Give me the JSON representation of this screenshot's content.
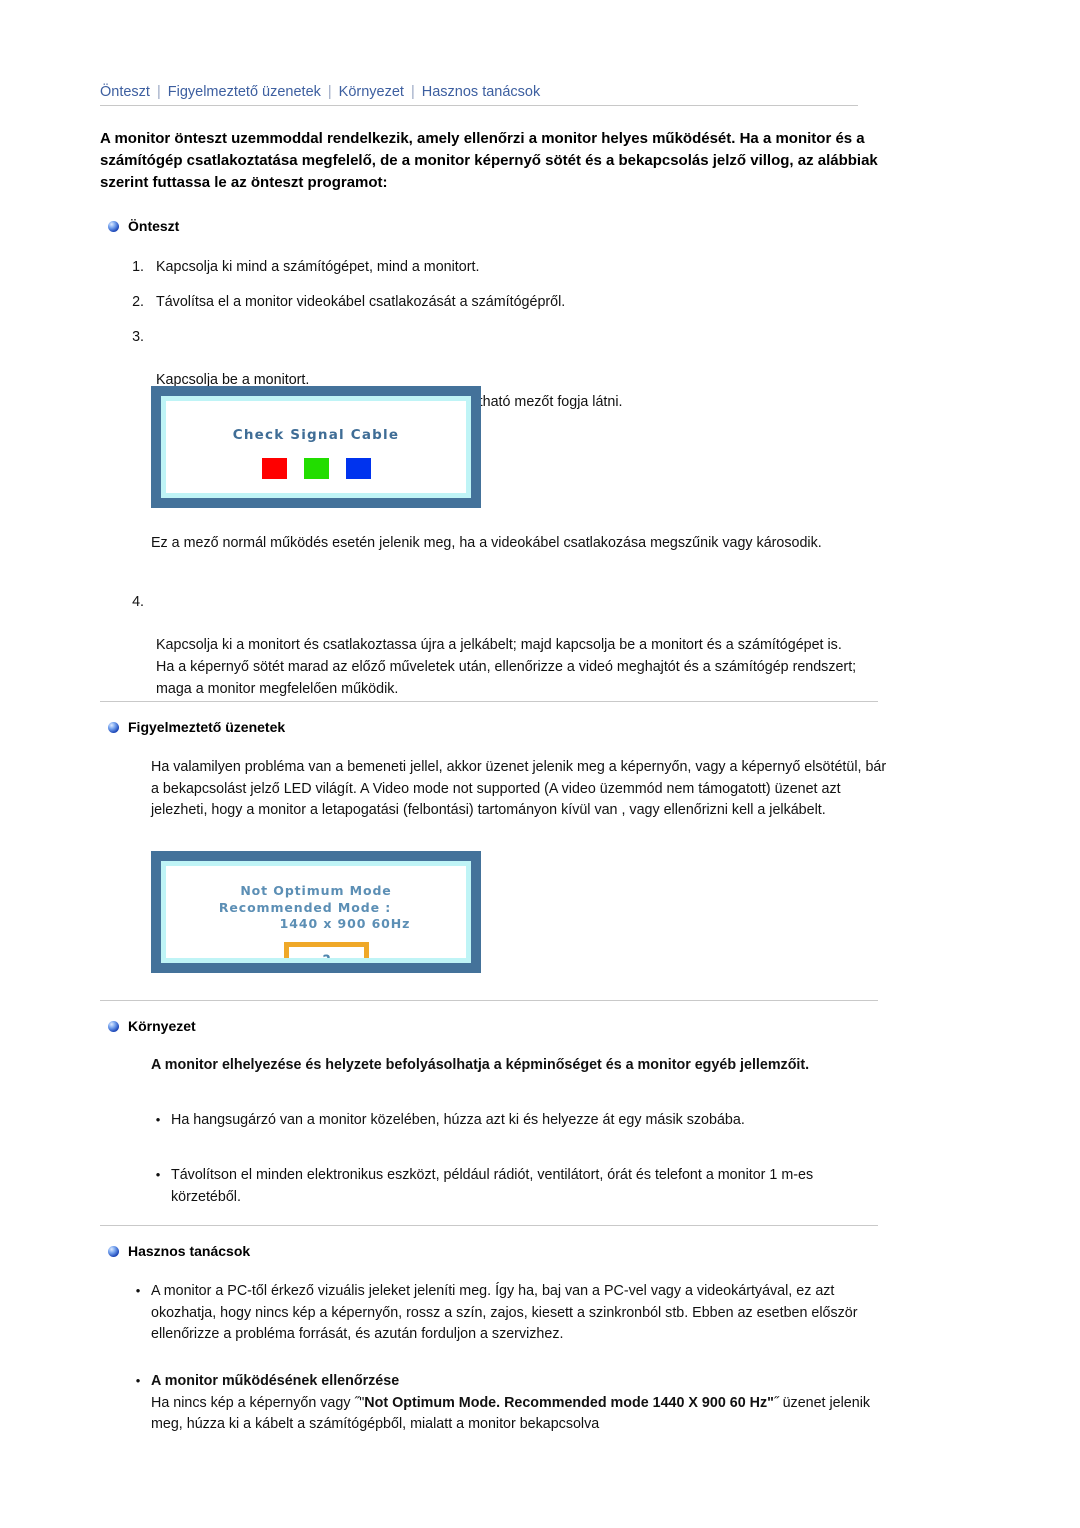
{
  "nav": {
    "items": [
      "Önteszt",
      "Figyelmeztető üzenetek",
      "Környezet",
      "Hasznos tanácsok"
    ],
    "separator": "|"
  },
  "intro": "A monitor önteszt uzemmoddal rendelkezik, amely ellenőrzi a monitor helyes működését. Ha a monitor és a számítógép csatlakoztatása megfelelő, de a monitor képernyő sötét és a bekapcsolás jelző villog, az alábbiak szerint futtassa le az önteszt programot:",
  "sections": {
    "selftest": {
      "heading": "Önteszt",
      "steps": [
        {
          "num": "1.",
          "text": "Kapcsolja ki mind a számítógépet, mind a monitort."
        },
        {
          "num": "2.",
          "text": "Távolítsa el a monitor videokábel csatlakozását a számítógépről."
        },
        {
          "num": "3.",
          "text": "Kapcsolja be a monitort.\nHa a monitor megfelelően működik, a lenti ábrán látható mezőt fogja látni."
        }
      ],
      "note": "Ez a mező normál működés esetén jelenik meg, ha a videokábel csatlakozása megszűnik vagy károsodik.",
      "step4": {
        "num": "4.",
        "text": "Kapcsolja ki a monitort és csatlakoztassa újra a jelkábelt; majd kapcsolja be a monitort és a számítógépet is.\nHa a képernyő sötét marad az előző műveletek után, ellenőrizze a videó meghajtót és a számítógép rendszert; maga a monitor megfelelően működik."
      },
      "figure": {
        "title": "Check Signal Cable",
        "colors": [
          "#ff0000",
          "#22dd00",
          "#0033ee"
        ],
        "frame_color": "#44729a",
        "bezel_color": "#bff4f6",
        "text_color": "#3f6d96"
      }
    },
    "warning": {
      "heading": "Figyelmeztető üzenetek",
      "body": "Ha valamilyen probléma van a bemeneti jellel, akkor üzenet jelenik meg a képernyőn, vagy a képernyő elsötétül, bár a bekapcsolást jelző LED világít. A Video mode not supported (A video üzemmód nem támogatott) üzenet azt jelezheti, hogy a monitor a letapogatási (felbontási) tartományon kívül van , vagy ellenőrizni kell a jelkábelt.",
      "figure": {
        "line1": "Not Optimum Mode",
        "line2": "Recommended Mode :",
        "line3": "1440 x 900 60Hz",
        "button": "?",
        "button_color": "#efa828",
        "text_color": "#5c8fb5"
      }
    },
    "environment": {
      "heading": "Környezet",
      "lead": "A monitor elhelyezése és helyzete befolyásolhatja a képminőséget és a monitor egyéb jellemzőit.",
      "bullets": [
        "Ha hangsugárzó van a monitor közelében, húzza azt ki és helyezze át egy másik szobába.",
        "Távolítson el minden elektronikus eszközt, például rádiót, ventilátort, órát és telefont a monitor 1 m-es körzetéből."
      ]
    },
    "tips": {
      "heading": "Hasznos tanácsok",
      "bullet1": "A monitor a PC-től érkező vizuális jeleket jeleníti meg. Így ha, baj van a PC-vel vagy a videokártyával, ez azt okozhatja, hogy nincs kép a képernyőn, rossz a szín, zajos, kiesett a szinkronból stb. Ebben az esetben először ellenőrizze a probléma forrását, és azután forduljon a szervizhez.",
      "bullet2_title": "A monitor működésének ellenőrzése",
      "bullet2_pre": "Ha nincs kép a képernyőn vagy ˝\"",
      "bullet2_bold": "Not Optimum Mode. Recommended mode 1440 X 900 60 Hz\"",
      "bullet2_post": "˝ üzenet jelenik meg, húzza ki a kábelt a számítógépből, mialatt a monitor bekapcsolva"
    }
  }
}
